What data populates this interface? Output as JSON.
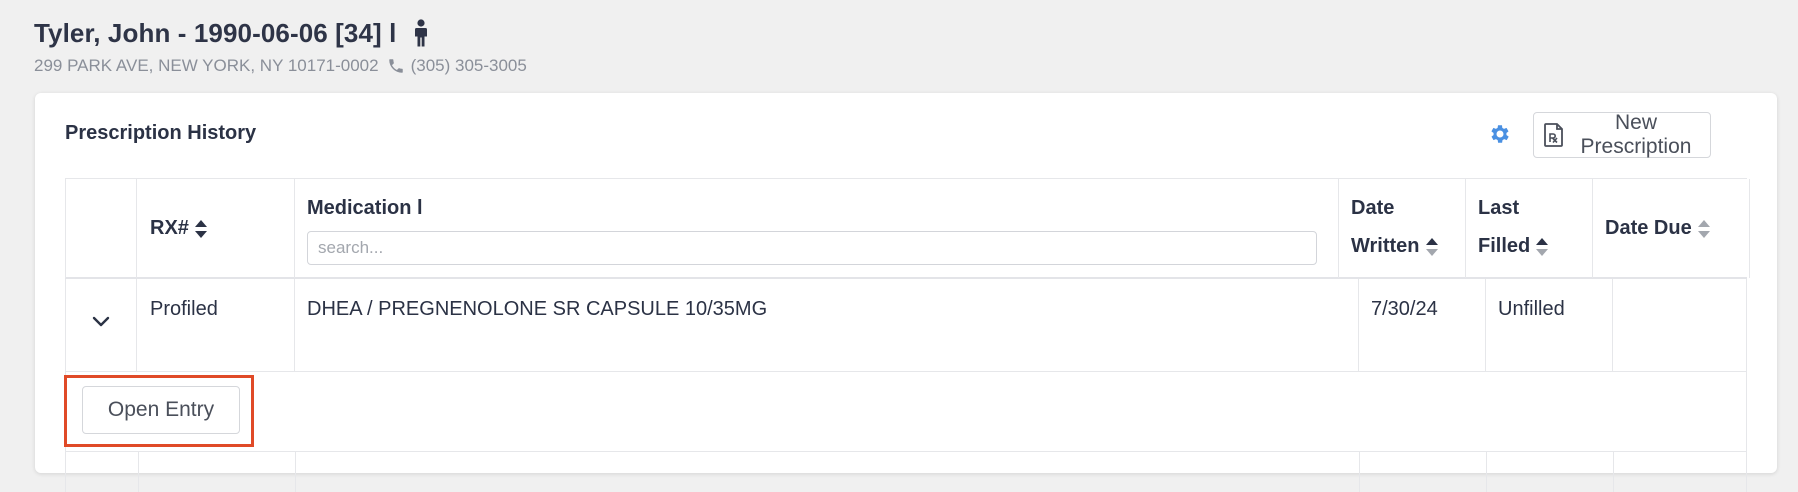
{
  "patient": {
    "name_line": "Tyler, John - 1990-06-06 [34] l",
    "address": "299 PARK AVE, NEW YORK, NY 10171-0002",
    "phone": "(305) 305-3005"
  },
  "card": {
    "title": "Prescription History",
    "new_prescription_label": "New Prescription"
  },
  "table": {
    "headers": {
      "rx": "RX#",
      "medication": "Medication l",
      "date_written_1": "Date",
      "date_written_2": "Written",
      "last_filled_1": "Last",
      "last_filled_2": "Filled",
      "date_due": "Date Due"
    },
    "search_placeholder": "search...",
    "rows": [
      {
        "rx": "Profiled",
        "medication": "DHEA / PREGNENOLONE SR CAPSULE 10/35MG",
        "date_written": "7/30/24",
        "last_filled": "Unfilled",
        "date_due": ""
      }
    ],
    "open_entry_label": "Open Entry"
  },
  "colors": {
    "accent_blue": "#4a90e2",
    "highlight_red": "#e04a27",
    "text_dark": "#2b3245",
    "text_muted": "#8a8f99"
  },
  "icons": {
    "person": "person-icon",
    "phone": "phone-icon",
    "gear": "gear-icon",
    "rx_doc": "prescription-document-icon",
    "sort": "sort-icon",
    "chevron": "chevron-down-icon"
  }
}
